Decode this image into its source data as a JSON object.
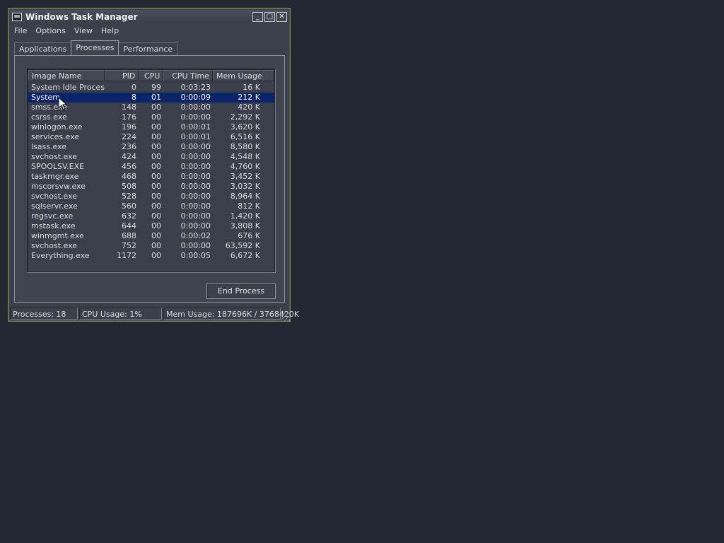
{
  "window": {
    "title": "Windows Task Manager",
    "controls": {
      "minimize": "_",
      "maximize": "□",
      "close": "✕"
    }
  },
  "menu": [
    "File",
    "Options",
    "View",
    "Help"
  ],
  "tabs": [
    {
      "label": "Applications",
      "active": false
    },
    {
      "label": "Processes",
      "active": true
    },
    {
      "label": "Performance",
      "active": false
    }
  ],
  "columns": {
    "name": "Image Name",
    "pid": "PID",
    "cpu": "CPU",
    "cpu_time": "CPU Time",
    "mem": "Mem Usage"
  },
  "processes": [
    {
      "name": "System Idle Process",
      "pid": "0",
      "cpu": "99",
      "cpu_time": "0:03:23",
      "mem": "16 K"
    },
    {
      "name": "System",
      "pid": "8",
      "cpu": "01",
      "cpu_time": "0:00:09",
      "mem": "212 K"
    },
    {
      "name": "smss.exe",
      "pid": "148",
      "cpu": "00",
      "cpu_time": "0:00:00",
      "mem": "420 K"
    },
    {
      "name": "csrss.exe",
      "pid": "176",
      "cpu": "00",
      "cpu_time": "0:00:00",
      "mem": "2,292 K"
    },
    {
      "name": "winlogon.exe",
      "pid": "196",
      "cpu": "00",
      "cpu_time": "0:00:01",
      "mem": "3,620 K"
    },
    {
      "name": "services.exe",
      "pid": "224",
      "cpu": "00",
      "cpu_time": "0:00:01",
      "mem": "6,516 K"
    },
    {
      "name": "lsass.exe",
      "pid": "236",
      "cpu": "00",
      "cpu_time": "0:00:00",
      "mem": "8,580 K"
    },
    {
      "name": "svchost.exe",
      "pid": "424",
      "cpu": "00",
      "cpu_time": "0:00:00",
      "mem": "4,548 K"
    },
    {
      "name": "SPOOLSV.EXE",
      "pid": "456",
      "cpu": "00",
      "cpu_time": "0:00:00",
      "mem": "4,760 K"
    },
    {
      "name": "taskmgr.exe",
      "pid": "468",
      "cpu": "00",
      "cpu_time": "0:00:00",
      "mem": "3,452 K"
    },
    {
      "name": "mscorsvw.exe",
      "pid": "508",
      "cpu": "00",
      "cpu_time": "0:00:00",
      "mem": "3,032 K"
    },
    {
      "name": "svchost.exe",
      "pid": "528",
      "cpu": "00",
      "cpu_time": "0:00:00",
      "mem": "8,964 K"
    },
    {
      "name": "sqlservr.exe",
      "pid": "560",
      "cpu": "00",
      "cpu_time": "0:00:00",
      "mem": "812 K"
    },
    {
      "name": "regsvc.exe",
      "pid": "632",
      "cpu": "00",
      "cpu_time": "0:00:00",
      "mem": "1,420 K"
    },
    {
      "name": "mstask.exe",
      "pid": "644",
      "cpu": "00",
      "cpu_time": "0:00:00",
      "mem": "3,808 K"
    },
    {
      "name": "winmgmt.exe",
      "pid": "688",
      "cpu": "00",
      "cpu_time": "0:00:02",
      "mem": "676 K"
    },
    {
      "name": "svchost.exe",
      "pid": "752",
      "cpu": "00",
      "cpu_time": "0:00:00",
      "mem": "63,592 K"
    },
    {
      "name": "Everything.exe",
      "pid": "1172",
      "cpu": "00",
      "cpu_time": "0:00:05",
      "mem": "6,672 K"
    }
  ],
  "selected_process": "System",
  "end_process_label": "End Process",
  "status": {
    "processes": "Processes: 18",
    "cpu": "CPU Usage: 1%",
    "mem": "Mem Usage: 187696K / 3768420K"
  },
  "colors": {
    "desktop": "#222832",
    "window": "#3b414b",
    "selection": "#0a246a",
    "border_accent": "#8a8a5a"
  }
}
